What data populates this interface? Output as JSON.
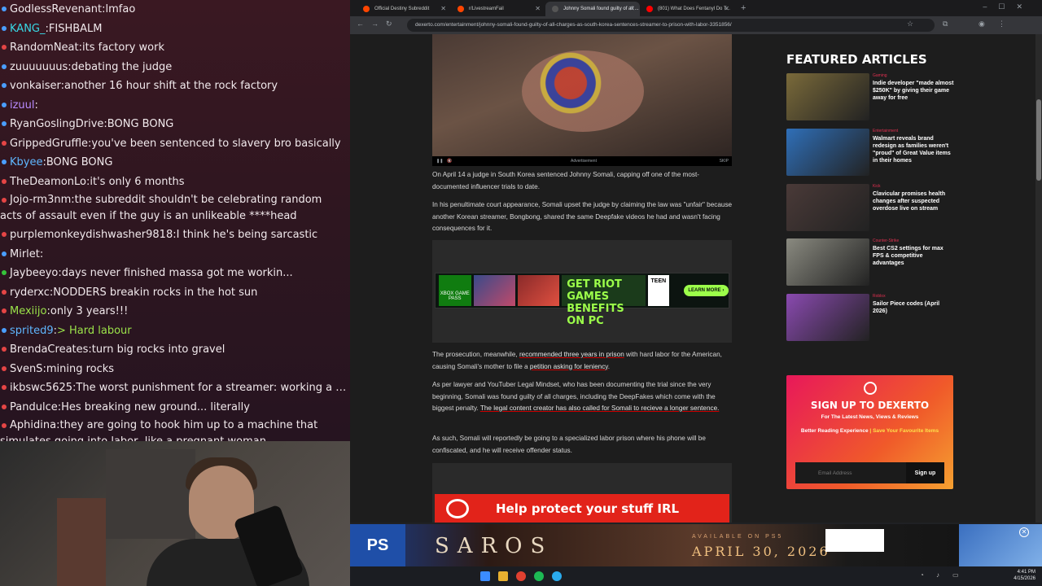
{
  "chat": {
    "messages": [
      {
        "user": "GodlessRevenant",
        "text": "lmfao",
        "color": "#f1e9ec",
        "dot": "#4a9eff"
      },
      {
        "user": "KANG_",
        "text": "FISHBALM",
        "color": "#38d9e6",
        "dot": "#4a9eff"
      },
      {
        "user": "RandomNeat",
        "text": "its factory work",
        "color": "#f1e9ec",
        "dot": "#e54545"
      },
      {
        "user": "zuuuuuuus",
        "text": "debating the judge",
        "color": "#f1e9ec",
        "dot": "#4a9eff"
      },
      {
        "user": "vonkaiser",
        "text": "another 16 hour shift at the rock factory",
        "color": "#f1e9ec",
        "dot": "#4a9eff"
      },
      {
        "user": "izuul",
        "text": "",
        "color": "#b98bff",
        "dot": "#4a9eff"
      },
      {
        "user": "RyanGoslingDrive",
        "text": "BONG BONG",
        "color": "#f1e9ec",
        "dot": "#4a9eff"
      },
      {
        "user": "GrippedGruffle",
        "text": "you've been sentenced to slavery bro basically",
        "color": "#f1e9ec",
        "dot": "#e54545"
      },
      {
        "user": "Kbyee",
        "text": "BONG BONG",
        "color": "#5fb7ff",
        "dot": "#4a9eff"
      },
      {
        "user": "TheDeamonLo",
        "text": "it's only 6 months",
        "color": "#f1e9ec",
        "dot": "#e54545"
      },
      {
        "user": "Jojo-rm3nm",
        "text": "the subreddit shouldn't be celebrating random acts of assault even if the guy is an unlikeable ****head",
        "color": "#f1e9ec",
        "dot": "#e54545",
        "wrap": true
      },
      {
        "user": "purplemonkeydishwasher9818",
        "text": "I think he's being sarcastic",
        "color": "#f1e9ec",
        "dot": "#e54545"
      },
      {
        "user": "Mirlet",
        "text": "",
        "color": "#f1e9ec",
        "dot": "#4a9eff"
      },
      {
        "user": "Jaybeeyo",
        "text": "days never finished massa got me workin...",
        "color": "#f1e9ec",
        "dot": "#36c43a"
      },
      {
        "user": "ryderxc",
        "text": "NODDERS breakin rocks in the hot sun",
        "color": "#f1e9ec",
        "dot": "#e54545"
      },
      {
        "user": "Mexiijo",
        "text": "only 3 years!!!",
        "color": "#9be34a",
        "dot": "#e54545"
      },
      {
        "user": "sprited9",
        "text": "> Hard labour",
        "color": "#5fb7ff",
        "dot": "#4a9eff",
        "textcolor": "#9be34a"
      },
      {
        "user": "BrendaCreates",
        "text": "turn big rocks into gravel",
        "color": "#f1e9ec",
        "dot": "#e54545"
      },
      {
        "user": "SvenS",
        "text": "mining rocks",
        "color": "#f1e9ec",
        "dot": "#e54545"
      },
      {
        "user": "ikbswc5625",
        "text": "The worst punishment for a streamer: working a job",
        "color": "#f1e9ec",
        "dot": "#e54545"
      },
      {
        "user": "Pandulce",
        "text": "Hes breaking new ground... literally",
        "color": "#f1e9ec",
        "dot": "#e54545"
      },
      {
        "user": "Aphidina",
        "text": "they are going to hook him up to a machine that simulates going into labor, like a pregnant woman",
        "color": "#f1e9ec",
        "dot": "#e54545",
        "wrap": true
      }
    ]
  },
  "browser": {
    "tabs": [
      {
        "label": "Official Destiny Subreddit",
        "active": false
      },
      {
        "label": "r/LivestreamFail",
        "active": false
      },
      {
        "label": "Johnny Somali found guilty of all ...",
        "active": true
      },
      {
        "label": "(801) What Does Fentanyl Do T...",
        "active": false
      }
    ],
    "url": "dexerto.com/entertainment/johnny-somali-found-guilty-of-all-charges-as-south-korea-sentences-streamer-to-prison-with-labor-3351856/"
  },
  "article": {
    "ad_label": "Advertisement",
    "skip_label": "SKIP",
    "p1": "On April 14 a judge in South Korea sentenced Johnny Somali, capping off one of the most-documented influencer trials to date.",
    "p2": "In his penultimate court appearance, Somali upset the judge by claiming the law was \"unfair\" because another Korean streamer, Bongbong, shared the same Deepfake videos he had and wasn't facing consequences for it.",
    "riot_ad": {
      "xbox": "XBOX GAME PASS",
      "headline": "GET RIOT GAMES BENEFITS ON PC",
      "teen": "TEEN",
      "cta": "LEARN MORE ›"
    },
    "p3_pre": "The prosecution, meanwhile, ",
    "p3_link1": "recommended three years in prison",
    "p3_mid": " with hard labor for the American, causing Somali's mother to file a ",
    "p3_link2": "petition asking for leniency",
    "p3_end": ".",
    "p4_pre": "As per lawyer and YouTuber Legal Mindset, who has been documenting the trial since the very beginning, Somali was found guilty of all charges, including the DeepFakes which come with the biggest penalty. ",
    "p4_link": "The legal content creator has also called for Somali to recieve a longer sentence.",
    "p5": "As such, Somali will reportedly be going to a specialized labor prison where his phone will be confiscated, and he will receive offender status.",
    "bottom_ad_text": "Help protect your stuff IRL"
  },
  "sidebar": {
    "title": "FEATURED ARTICLES",
    "cards": [
      {
        "category": "Gaming",
        "title": "Indie developer \"made almost $250K\" by giving their game away for free",
        "thumb": "#7a6a3a"
      },
      {
        "category": "Entertainment",
        "title": "Walmart reveals brand redesign as families weren't \"proud\" of Great Value items in their homes",
        "thumb": "#2f6fb8"
      },
      {
        "category": "Kick",
        "title": "Clavicular promises health changes after suspected overdose live on stream",
        "thumb": "#4a3a38"
      },
      {
        "category": "Counter-Strike",
        "title": "Best CS2 settings for max FPS & competitive advantages",
        "thumb": "#8a8a80"
      },
      {
        "category": "Roblox",
        "title": "Sailor Piece codes (April 2026)",
        "thumb": "#8a4ab0"
      }
    ]
  },
  "signup": {
    "heading": "SIGN UP TO DEXERTO",
    "sub": "For The Latest News, Views & Reviews",
    "perk1": "Better Reading Experience",
    "perk2": "Save Your Favourite Items",
    "sep": " | ",
    "email_placeholder": "Email Address",
    "button": "Sign up"
  },
  "promo": {
    "brand": "SAROS",
    "avail": "AVAILABLE ON PS5",
    "date": "APRIL 30, 2026",
    "close": "✕"
  },
  "taskbar": {
    "time": "4:41 PM",
    "date": "4/15/2026"
  }
}
